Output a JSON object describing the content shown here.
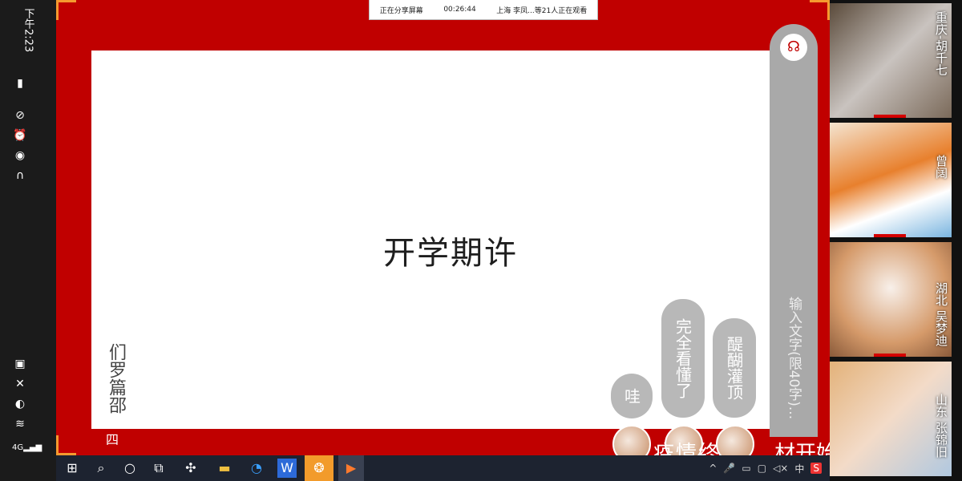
{
  "status_bar": {
    "time": "下午2:23",
    "network": "4G"
  },
  "share_banner": {
    "sharing_text": "正在分享屏幕",
    "duration": "00:26:44",
    "viewers_text": "上海 李凤...等21人正在观看"
  },
  "slide": {
    "title": "开学期许",
    "vertical_text": "们罗篇邵"
  },
  "chat_panel": {
    "input_placeholder": "输入文字(限40字)..."
  },
  "danmu": [
    {
      "text": "哇"
    },
    {
      "text": "完全看懂了"
    },
    {
      "text": "醍醐灌顶"
    }
  ],
  "bottom_text": {
    "left": "疫情终…",
    "right": "材开始"
  },
  "taskbar": {
    "tray_ime": "中",
    "tray_s": "S"
  },
  "participants": [
    {
      "name": "重庆-胡千七"
    },
    {
      "name": "曾阔"
    },
    {
      "name": "湖北 吴梦迪"
    },
    {
      "name": "山东 张锦旧"
    }
  ],
  "colors": {
    "share_bg": "#c00000",
    "accent": "#f59a2f"
  }
}
